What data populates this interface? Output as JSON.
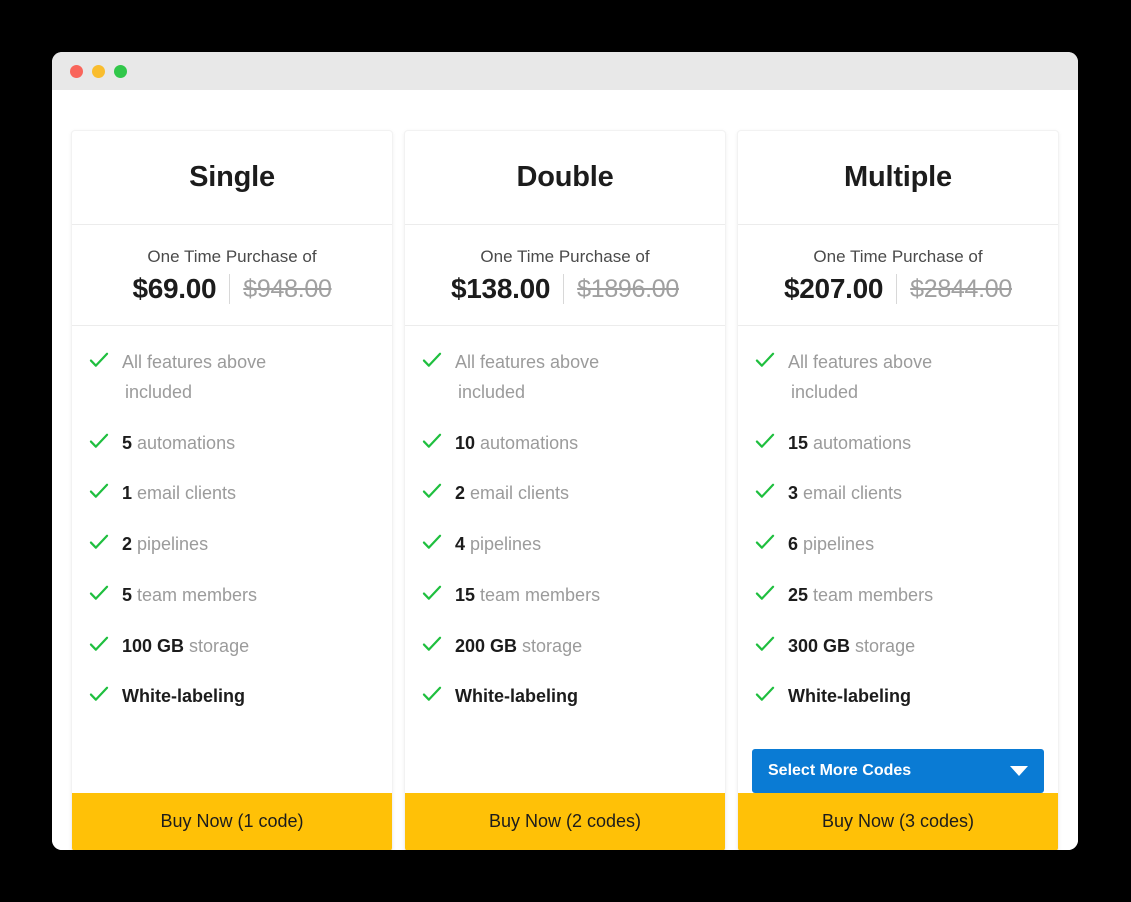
{
  "window": {
    "traffic_lights": [
      {
        "name": "close",
        "color": "#f9655b"
      },
      {
        "name": "minimize",
        "color": "#f9bd2e"
      },
      {
        "name": "maximize",
        "color": "#31c74a"
      }
    ]
  },
  "theme": {
    "accent_blue": "#0a7bd4",
    "accent_yellow": "#ffc107",
    "check_green": "#1fbf3f",
    "text_dark": "#1c1c1c",
    "text_muted": "#9b9b9b"
  },
  "plans": [
    {
      "name": "Single",
      "price_caption": "One Time Purchase of",
      "price_current": "$69.00",
      "price_old": "$948.00",
      "features": [
        {
          "emph": "",
          "rest": "All features above",
          "second_line": "included",
          "bold_all": false
        },
        {
          "emph": "5",
          "rest": " automations",
          "second_line": "",
          "bold_all": false
        },
        {
          "emph": "1",
          "rest": " email clients",
          "second_line": "",
          "bold_all": false
        },
        {
          "emph": "2",
          "rest": " pipelines",
          "second_line": "",
          "bold_all": false
        },
        {
          "emph": "5",
          "rest": " team members",
          "second_line": "",
          "bold_all": false
        },
        {
          "emph": "100 GB",
          "rest": " storage",
          "second_line": "",
          "bold_all": false
        },
        {
          "emph": "",
          "rest": "White-labeling",
          "second_line": "",
          "bold_all": true
        }
      ],
      "select_codes": null,
      "buy_label": "Buy Now (1 code)"
    },
    {
      "name": "Double",
      "price_caption": "One Time Purchase of",
      "price_current": "$138.00",
      "price_old": "$1896.00",
      "features": [
        {
          "emph": "",
          "rest": "All features above",
          "second_line": "included",
          "bold_all": false
        },
        {
          "emph": "10",
          "rest": " automations",
          "second_line": "",
          "bold_all": false
        },
        {
          "emph": "2",
          "rest": " email clients",
          "second_line": "",
          "bold_all": false
        },
        {
          "emph": "4",
          "rest": " pipelines",
          "second_line": "",
          "bold_all": false
        },
        {
          "emph": "15",
          "rest": " team members",
          "second_line": "",
          "bold_all": false
        },
        {
          "emph": "200 GB",
          "rest": " storage",
          "second_line": "",
          "bold_all": false
        },
        {
          "emph": "",
          "rest": "White-labeling",
          "second_line": "",
          "bold_all": true
        }
      ],
      "select_codes": null,
      "buy_label": "Buy Now (2 codes)"
    },
    {
      "name": "Multiple",
      "price_caption": "One Time Purchase of",
      "price_current": "$207.00",
      "price_old": "$2844.00",
      "features": [
        {
          "emph": "",
          "rest": "All features above",
          "second_line": "included",
          "bold_all": false
        },
        {
          "emph": "15",
          "rest": " automations",
          "second_line": "",
          "bold_all": false
        },
        {
          "emph": "3",
          "rest": " email clients",
          "second_line": "",
          "bold_all": false
        },
        {
          "emph": "6",
          "rest": " pipelines",
          "second_line": "",
          "bold_all": false
        },
        {
          "emph": "25",
          "rest": " team members",
          "second_line": "",
          "bold_all": false
        },
        {
          "emph": "300 GB",
          "rest": " storage",
          "second_line": "",
          "bold_all": false
        },
        {
          "emph": "",
          "rest": "White-labeling",
          "second_line": "",
          "bold_all": true
        }
      ],
      "select_codes": "Select More Codes",
      "buy_label": "Buy Now (3 codes)"
    }
  ]
}
